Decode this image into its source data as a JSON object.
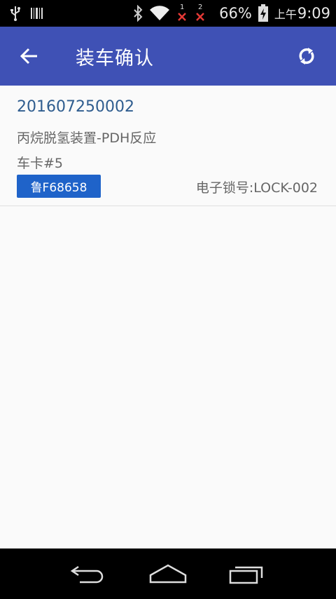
{
  "status_bar": {
    "icons": [
      "usb-icon",
      "barcode-icon",
      "bluetooth-icon",
      "wifi-icon",
      "signal-sim1-no-service-icon",
      "signal-sim2-no-service-icon",
      "battery-charging-icon"
    ],
    "sim1_label": "1",
    "sim2_label": "2",
    "battery": "66%",
    "time_prefix": "上午",
    "time": "9:09"
  },
  "app_bar": {
    "title": "装车确认",
    "background": "#3f51b5",
    "back_icon": "arrow-left-icon",
    "refresh_icon": "refresh-icon"
  },
  "list": {
    "items": [
      {
        "order_no": "201607250002",
        "device": "丙烷脱氢装置-PDH反应",
        "card": "车卡#5",
        "plate": "鲁F68658",
        "lock": "电子锁号:LOCK-002"
      }
    ]
  },
  "colors": {
    "accent": "#3f51b5",
    "badge": "#1f63c9",
    "order_text": "#2f5d8f"
  },
  "nav_bar": {
    "icons": [
      "back-nav-icon",
      "home-nav-icon",
      "recents-nav-icon"
    ]
  }
}
